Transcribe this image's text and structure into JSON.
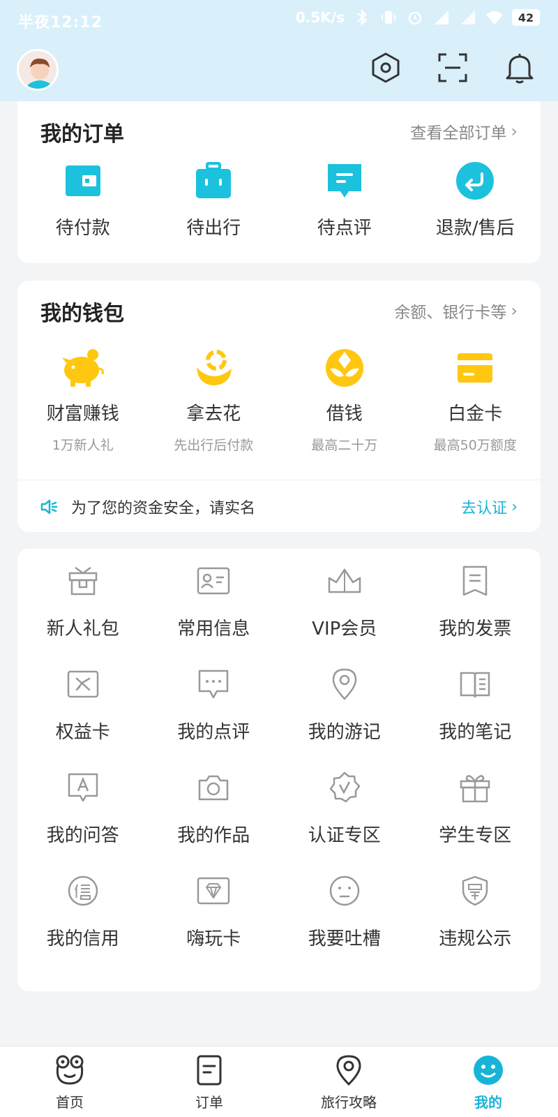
{
  "status_bar": {
    "time": "半夜12:12",
    "speed": "0.5K/s",
    "battery": "42"
  },
  "header": {
    "icons": [
      "settings-icon",
      "scan-icon",
      "bell-icon"
    ]
  },
  "orders": {
    "title": "我的订单",
    "link": "查看全部订单",
    "items": [
      {
        "label": "待付款",
        "icon": "wallet-icon"
      },
      {
        "label": "待出行",
        "icon": "suitcase-icon"
      },
      {
        "label": "待点评",
        "icon": "comment-icon"
      },
      {
        "label": "退款/售后",
        "icon": "refund-icon"
      }
    ],
    "accent": "#1cc1dd"
  },
  "wallet": {
    "title": "我的钱包",
    "link": "余额、银行卡等",
    "items": [
      {
        "label": "财富赚钱",
        "sub": "1万新人礼",
        "icon": "piggy-bank-icon"
      },
      {
        "label": "拿去花",
        "sub": "先出行后付款",
        "icon": "smile-coin-icon"
      },
      {
        "label": "借钱",
        "sub": "最高二十万",
        "icon": "yuan-coin-icon"
      },
      {
        "label": "白金卡",
        "sub": "最高50万额度",
        "icon": "card-icon"
      }
    ],
    "accent": "#ffc710",
    "notice": {
      "text": "为了您的资金安全，请实名",
      "action": "去认证"
    }
  },
  "services": {
    "rows": [
      [
        {
          "label": "新人礼包",
          "icon": "gift-box-icon"
        },
        {
          "label": "常用信息",
          "icon": "id-card-icon"
        },
        {
          "label": "VIP会员",
          "icon": "crown-icon"
        },
        {
          "label": "我的发票",
          "icon": "invoice-icon"
        }
      ],
      [
        {
          "label": "权益卡",
          "icon": "plane-card-icon"
        },
        {
          "label": "我的点评",
          "icon": "chat-bubble-icon"
        },
        {
          "label": "我的游记",
          "icon": "location-pin-icon"
        },
        {
          "label": "我的笔记",
          "icon": "notebook-icon"
        }
      ],
      [
        {
          "label": "我的问答",
          "icon": "qa-icon"
        },
        {
          "label": "我的作品",
          "icon": "camera-icon"
        },
        {
          "label": "认证专区",
          "icon": "verified-badge-icon"
        },
        {
          "label": "学生专区",
          "icon": "present-icon"
        }
      ],
      [
        {
          "label": "我的信用",
          "icon": "credit-icon"
        },
        {
          "label": "嗨玩卡",
          "icon": "diamond-card-icon"
        },
        {
          "label": "我要吐槽",
          "icon": "face-icon"
        },
        {
          "label": "违规公示",
          "icon": "shield-penalty-icon"
        }
      ]
    ]
  },
  "tabbar": {
    "items": [
      {
        "label": "首页",
        "icon": "home-frog-icon"
      },
      {
        "label": "订单",
        "icon": "order-doc-icon"
      },
      {
        "label": "旅行攻略",
        "icon": "map-pin-icon"
      },
      {
        "label": "我的",
        "icon": "profile-icon"
      }
    ],
    "active_index": 3,
    "active_color": "#18b4d8"
  }
}
